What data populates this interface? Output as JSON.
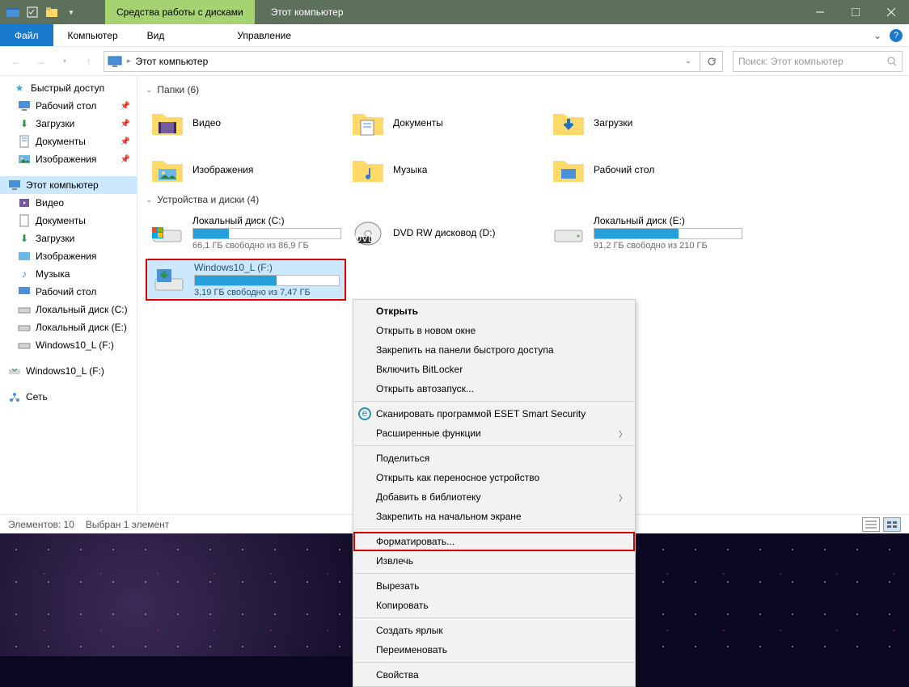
{
  "title": {
    "context": "Средства работы с дисками",
    "text": "Этот компьютер"
  },
  "menubar": {
    "file": "Файл",
    "computer": "Компьютер",
    "view": "Вид",
    "manage": "Управление"
  },
  "address": {
    "text": "Этот компьютер"
  },
  "search": {
    "placeholder": "Поиск: Этот компьютер"
  },
  "sidebar": {
    "quick": "Быстрый доступ",
    "desktop": "Рабочий стол",
    "downloads": "Загрузки",
    "documents": "Документы",
    "pictures": "Изображения",
    "thispc": "Этот компьютер",
    "videos": "Видео",
    "documents2": "Документы",
    "downloads2": "Загрузки",
    "pictures2": "Изображения",
    "music": "Музыка",
    "desktop2": "Рабочий стол",
    "localC": "Локальный диск (C:)",
    "localE": "Локальный диск (E:)",
    "winF": "Windows10_L (F:)",
    "winF2": "Windows10_L (F:)",
    "network": "Сеть"
  },
  "groups": {
    "folders": "Папки (6)",
    "drives": "Устройства и диски (4)"
  },
  "folders": {
    "video": "Видео",
    "documents": "Документы",
    "downloads": "Загрузки",
    "pictures": "Изображения",
    "music": "Музыка",
    "desktop": "Рабочий стол"
  },
  "drives": {
    "c": {
      "name": "Локальный диск (C:)",
      "free": "66,1 ГБ свободно из 86,9 ГБ",
      "fill": 24
    },
    "dvd": {
      "name": "DVD RW дисковод (D:)"
    },
    "e": {
      "name": "Локальный диск (E:)",
      "free": "91,2 ГБ свободно из 210 ГБ",
      "fill": 57
    },
    "f": {
      "name": "Windows10_L (F:)",
      "free": "3,19 ГБ свободно из 7,47 ГБ",
      "fill": 57
    }
  },
  "status": {
    "left": "Элементов: 10",
    "sel": "Выбран 1 элемент"
  },
  "ctx": {
    "open": "Открыть",
    "open_new": "Открыть в новом окне",
    "pin_quick": "Закрепить на панели быстрого доступа",
    "bitlocker": "Включить BitLocker",
    "autoplay": "Открыть автозапуск...",
    "eset": "Сканировать программой ESET Smart Security",
    "advanced": "Расширенные функции",
    "share": "Поделиться",
    "portable": "Открыть как переносное устройство",
    "library": "Добавить в библиотеку",
    "pin_start": "Закрепить на начальном экране",
    "format": "Форматировать...",
    "eject": "Извлечь",
    "cut": "Вырезать",
    "copy": "Копировать",
    "shortcut": "Создать ярлык",
    "rename": "Переименовать",
    "properties": "Свойства"
  }
}
